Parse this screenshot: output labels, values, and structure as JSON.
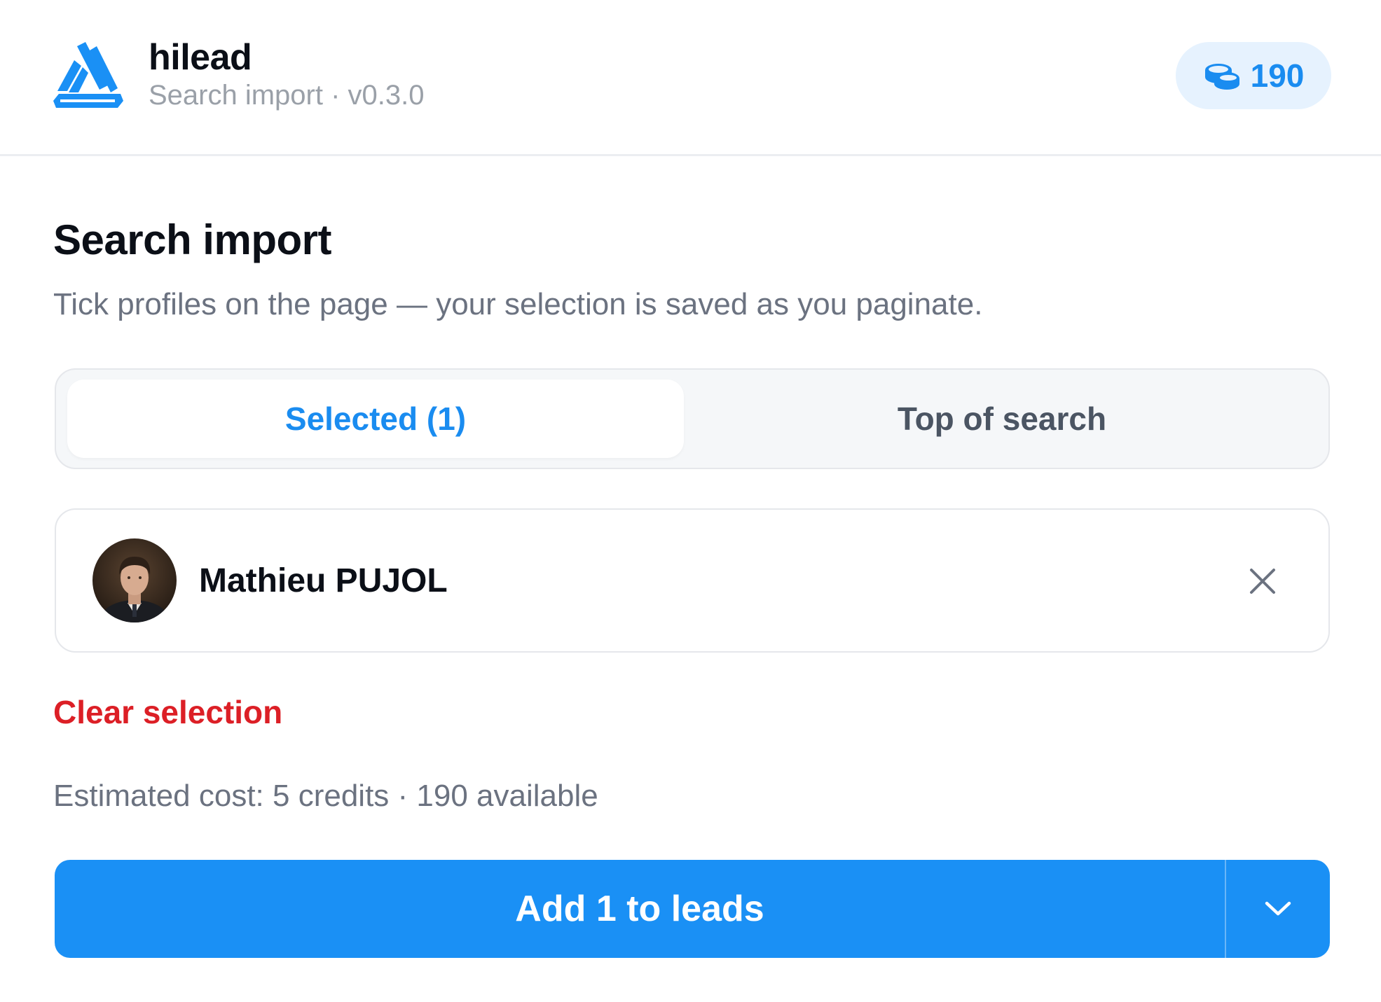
{
  "header": {
    "brand_name": "hilead",
    "subtitle": "Search import · v0.3.0",
    "credits": "190",
    "icons": {
      "logo": "hilead-logo",
      "credits": "coins-icon"
    }
  },
  "main": {
    "title": "Search import",
    "description": "Tick profiles on the page — your selection is saved as you paginate.",
    "tabs": [
      {
        "label": "Selected (1)",
        "active": true
      },
      {
        "label": "Top of search",
        "active": false
      }
    ],
    "selected_profiles": [
      {
        "name": "Mathieu PUJOL"
      }
    ],
    "clear_label": "Clear selection",
    "estimate": "Estimated cost: 5 credits · 190 available",
    "primary_action": "Add 1 to leads"
  },
  "colors": {
    "accent": "#1a90f5",
    "accent_text": "#1a8cf0",
    "danger": "#dc1f26",
    "muted_text": "#6b7280"
  }
}
